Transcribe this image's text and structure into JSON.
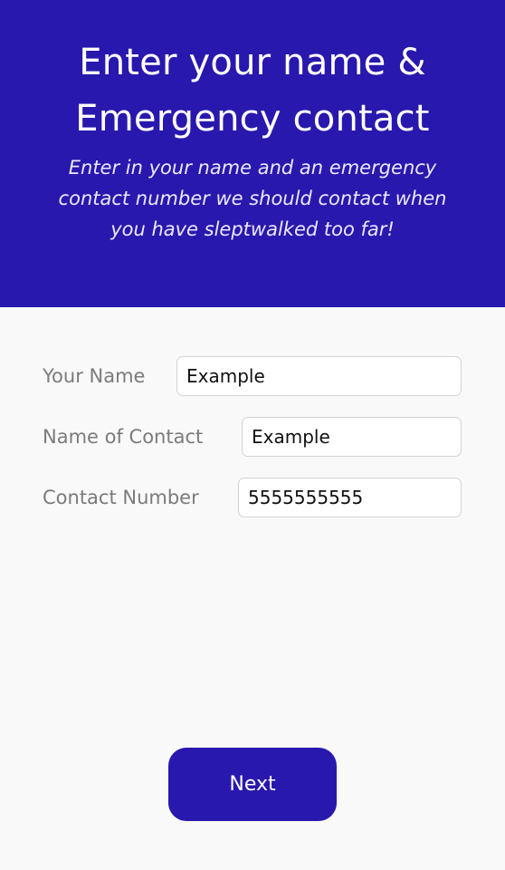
{
  "header": {
    "title_line1": "Enter your name &",
    "title_line2": "Emergency contact",
    "subtitle_line1": "Enter in your name and an emergency",
    "subtitle_line2": "contact number we should contact when",
    "subtitle_line3": "you have sleptwalked too far!"
  },
  "form": {
    "your_name_label": "Your Name",
    "your_name_value": "Example",
    "contact_name_label": "Name of Contact",
    "contact_name_value": "Example",
    "contact_number_label": "Contact Number",
    "contact_number_value": "5555555555"
  },
  "actions": {
    "next_label": "Next"
  },
  "colors": {
    "brand": "#2918ad",
    "background": "#f9f9f9"
  }
}
